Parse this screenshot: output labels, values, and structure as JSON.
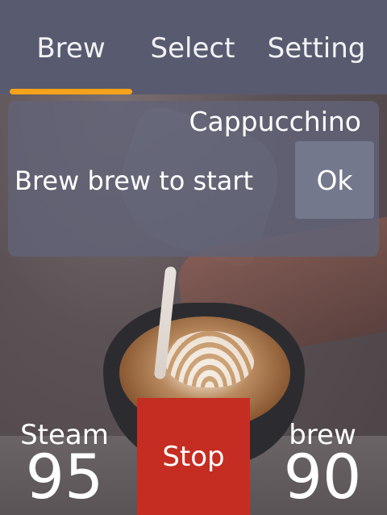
{
  "tabs": {
    "brew": "Brew",
    "select": "Select",
    "setting": "Setting",
    "active": "Brew",
    "indicator_color": "#f6a21a"
  },
  "message": {
    "title": "Cappucchino",
    "text": "Brew brew to start",
    "ok_label": "Ok"
  },
  "controls": {
    "stop_label": "Stop",
    "stop_color": "#c62d22"
  },
  "readouts": {
    "steam_label": "Steam",
    "steam_value": "95",
    "brew_label": "brew",
    "brew_value": "90"
  },
  "background": {
    "image": "latte-art-coffee-cup-photo"
  }
}
